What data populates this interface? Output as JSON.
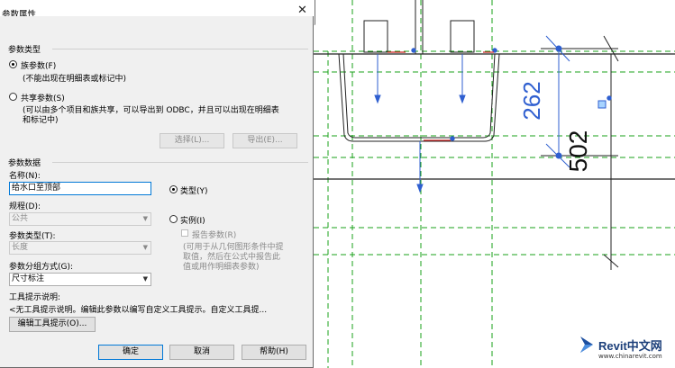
{
  "dialog": {
    "title": "参数属性",
    "close_glyph": "✕",
    "param_type_group": "参数类型",
    "family_param": "族参数(F)",
    "family_param_desc": "(不能出现在明细表或标记中)",
    "shared_param": "共享参数(S)",
    "shared_param_desc_1": "(可以由多个项目和族共享，可以导出到 ODBC，并且可以出现在明细表",
    "shared_param_desc_2": "和标记中)",
    "select_button": "选择(L)...",
    "export_button": "导出(E)...",
    "param_data_group": "参数数据",
    "name_label": "名称(N):",
    "name_value": "给水口至顶部",
    "discipline_label": "规程(D):",
    "discipline_value": "公共",
    "param_type_label": "参数类型(T):",
    "param_type_value": "长度",
    "group_label": "参数分组方式(G):",
    "group_value": "尺寸标注",
    "type_radio": "类型(Y)",
    "instance_radio": "实例(I)",
    "report_param": "报告参数(R)",
    "report_desc_1": "(可用于从几何图形条件中提",
    "report_desc_2": "取值，然后在公式中报告此",
    "report_desc_3": "值或用作明细表参数)",
    "tooltip_label": "工具提示说明:",
    "tooltip_value": "<无工具提示说明。编辑此参数以编写自定义工具提示。自定义工具提...",
    "edit_tooltip_button": "编辑工具提示(O)...",
    "ok_button": "确定",
    "cancel_button": "取消",
    "help_button": "帮助(H)"
  },
  "drawing": {
    "dim_262": "262",
    "dim_502": "502",
    "accent_blue": "#2f5fd0",
    "green_line": "#1aa01a"
  },
  "watermark": {
    "brand": "Revit中文网",
    "url": "www.chinarevit.com"
  }
}
